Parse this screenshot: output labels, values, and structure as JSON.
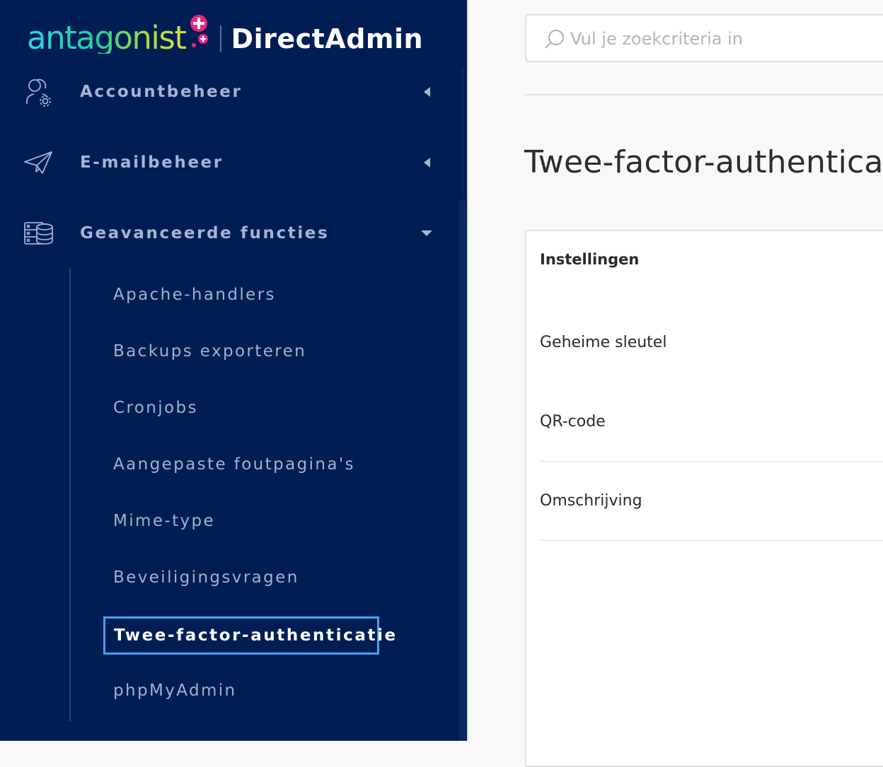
{
  "brand": {
    "name": "antagonist",
    "product": "DirectAdmin",
    "colors": {
      "sidebar": "#001e53",
      "accent": "#4a9df2",
      "logo_pink": "#e8267e"
    }
  },
  "sidebar": {
    "sections": [
      {
        "label": "Accountbeheer",
        "icon": "account-settings-icon",
        "state": "collapsed"
      },
      {
        "label": "E-mailbeheer",
        "icon": "paper-plane-icon",
        "state": "collapsed"
      },
      {
        "label": "Geavanceerde functies",
        "icon": "server-database-icon",
        "state": "expanded"
      }
    ],
    "submenu": [
      {
        "label": "Apache-handlers"
      },
      {
        "label": "Backups exporteren"
      },
      {
        "label": "Cronjobs"
      },
      {
        "label": "Aangepaste foutpagina's"
      },
      {
        "label": "Mime-type"
      },
      {
        "label": "Beveiligingsvragen"
      },
      {
        "label": "Twee-factor-authenticatie",
        "active": true
      },
      {
        "label": "phpMyAdmin"
      }
    ]
  },
  "search": {
    "placeholder": "Vul je zoekcriteria in",
    "value": ""
  },
  "main": {
    "title": "Twee-factor-authenticatie",
    "panel": {
      "header": "Instellingen",
      "rows": [
        "Geheime sleutel",
        "QR-code",
        "Omschrijving"
      ]
    }
  }
}
